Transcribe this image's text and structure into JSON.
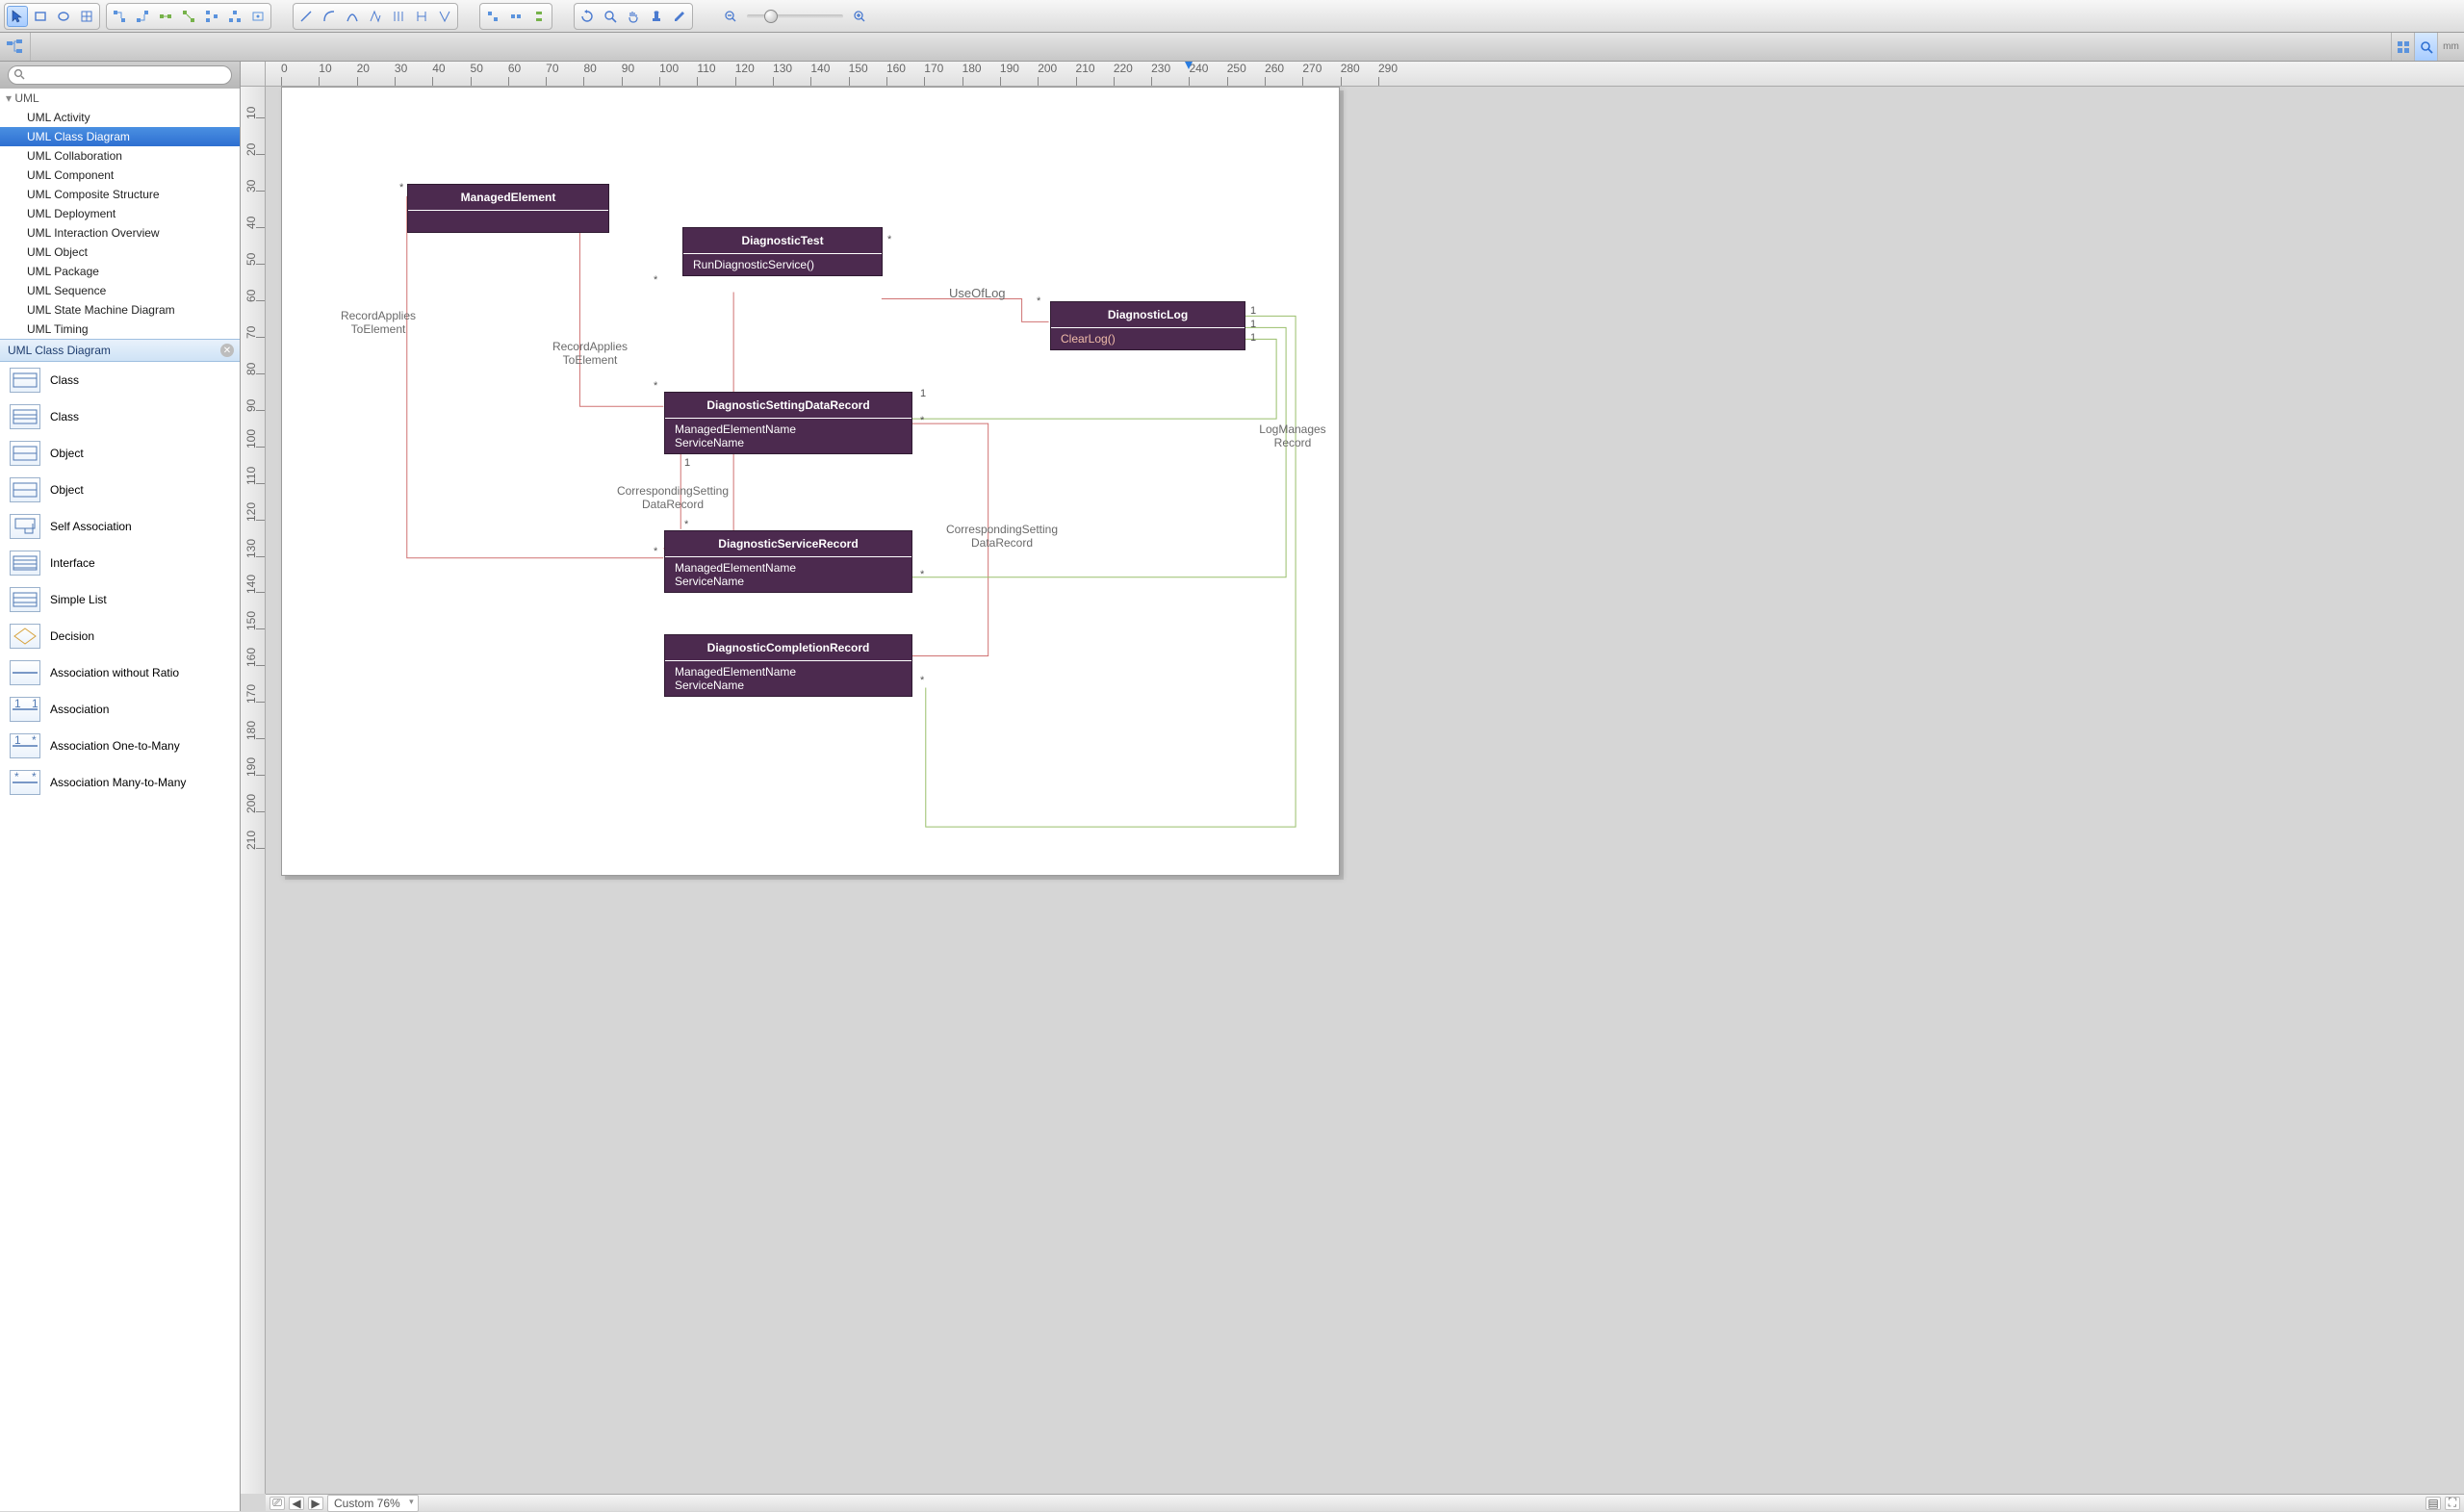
{
  "subbar": {
    "unit": "mm"
  },
  "sidebar": {
    "tree_header": "UML",
    "tree_items": [
      "UML Activity",
      "UML Class Diagram",
      "UML Collaboration",
      "UML Component",
      "UML Composite Structure",
      "UML Deployment",
      "UML Interaction Overview",
      "UML Object",
      "UML Package",
      "UML Sequence",
      "UML State Machine Diagram",
      "UML Timing"
    ],
    "tree_selected_index": 1,
    "panel_title": "UML Class Diagram",
    "shapes": [
      "Class",
      "Class",
      "Object",
      "Object",
      "Self Association",
      "Interface",
      "Simple List",
      "Decision",
      "Association without Ratio",
      "Association",
      "Association One-to-Many",
      "Association Many-to-Many"
    ]
  },
  "ruler": {
    "h_marker_mm": 240,
    "h_max_mm": 290,
    "v_max_mm": 210
  },
  "statusbar": {
    "zoom": "Custom 76%"
  },
  "diagram": {
    "classes": {
      "managed_element": {
        "title": "ManagedElement"
      },
      "diagnostic_test": {
        "title": "DiagnosticTest",
        "ops": [
          "RunDiagnosticService()"
        ]
      },
      "diagnostic_log": {
        "title": "DiagnosticLog",
        "ops": [
          "ClearLog()"
        ]
      },
      "setting_record": {
        "title": "DiagnosticSettingDataRecord",
        "attrs": [
          "ManagedElementName",
          "ServiceName"
        ]
      },
      "service_record": {
        "title": "DiagnosticServiceRecord",
        "attrs": [
          "ManagedElementName",
          "ServiceName"
        ]
      },
      "completion_record": {
        "title": "DiagnosticCompletionRecord",
        "attrs": [
          "ManagedElementName",
          "ServiceName"
        ]
      }
    },
    "labels": {
      "record_applies_1a": "RecordApplies",
      "record_applies_1b": "ToElement",
      "record_applies_2a": "RecordApplies",
      "record_applies_2b": "ToElement",
      "use_of_log": "UseOfLog",
      "corr_1a": "CorrespondingSetting",
      "corr_1b": "DataRecord",
      "corr_2a": "CorrespondingSetting",
      "corr_2b": "DataRecord",
      "logmanages_a": "LogManages",
      "logmanages_b": "Record"
    },
    "mult": {
      "star": "*",
      "one": "1"
    }
  }
}
